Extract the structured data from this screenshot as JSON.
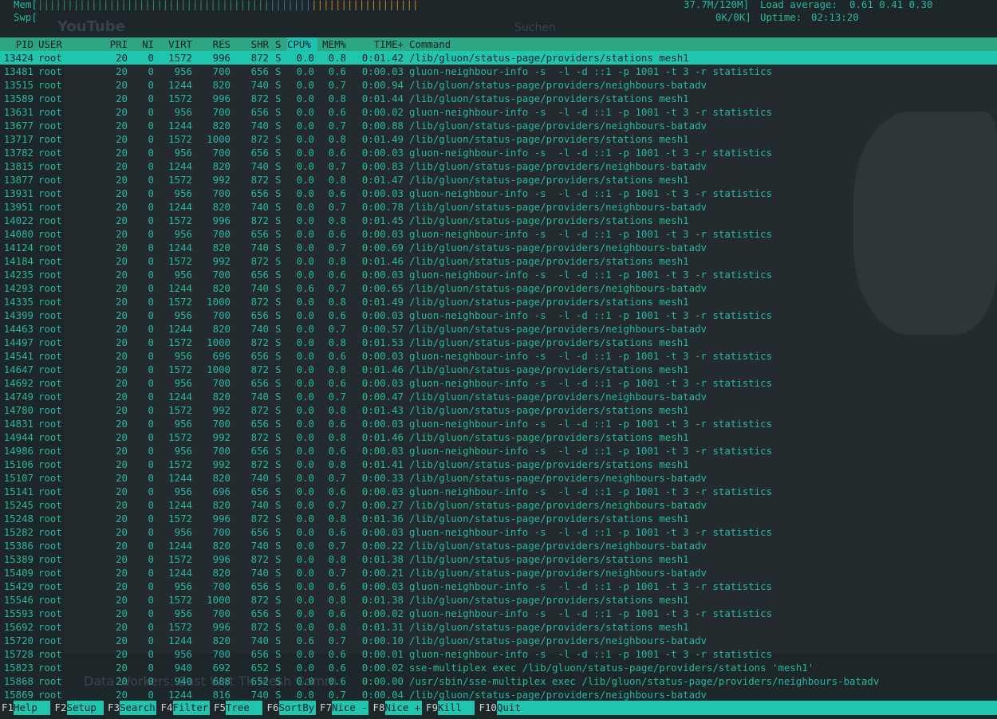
{
  "background": {
    "site_logo": "YouTube",
    "search_placeholder": "Suchen",
    "video_title": "Data Workers: East Wat Tk Mesh Comm"
  },
  "header": {
    "mem_label": "Mem[",
    "mem_bar": "||||||||||||||||||||||||||||||||||||||||||||||||||||||||||||||||||||",
    "mem_value": "37.7M/120M]",
    "swp_label": "Swp[",
    "swp_value": "0K/0K]",
    "load_label": "Load average:",
    "load_values": "0.61 0.41 0.30",
    "uptime_label": "Uptime:",
    "uptime_value": "02:13:20"
  },
  "columns": [
    "PID",
    "USER",
    "PRI",
    "NI",
    "VIRT",
    "RES",
    "SHR",
    "S",
    "CPU%",
    "MEM%",
    "TIME+",
    "Command"
  ],
  "sort_column": "CPU%",
  "selected_index": 0,
  "processes": [
    [
      "13424",
      "root",
      "20",
      "0",
      "1572",
      "996",
      "872",
      "S",
      "0.0",
      "0.8",
      "0:01.42",
      "/lib/gluon/status-page/providers/stations mesh1"
    ],
    [
      "13481",
      "root",
      "20",
      "0",
      "956",
      "700",
      "656",
      "S",
      "0.0",
      "0.6",
      "0:00.03",
      "gluon-neighbour-info -s  -l -d ::1 -p 1001 -t 3 -r statistics"
    ],
    [
      "13515",
      "root",
      "20",
      "0",
      "1244",
      "820",
      "740",
      "S",
      "0.0",
      "0.7",
      "0:00.94",
      "/lib/gluon/status-page/providers/neighbours-batadv"
    ],
    [
      "13589",
      "root",
      "20",
      "0",
      "1572",
      "996",
      "872",
      "S",
      "0.0",
      "0.8",
      "0:01.44",
      "/lib/gluon/status-page/providers/stations mesh1"
    ],
    [
      "13631",
      "root",
      "20",
      "0",
      "956",
      "700",
      "656",
      "S",
      "0.0",
      "0.6",
      "0:00.02",
      "gluon-neighbour-info -s  -l -d ::1 -p 1001 -t 3 -r statistics"
    ],
    [
      "13677",
      "root",
      "20",
      "0",
      "1244",
      "820",
      "740",
      "S",
      "0.0",
      "0.7",
      "0:00.88",
      "/lib/gluon/status-page/providers/neighbours-batadv"
    ],
    [
      "13717",
      "root",
      "20",
      "0",
      "1572",
      "1000",
      "872",
      "S",
      "0.0",
      "0.8",
      "0:01.49",
      "/lib/gluon/status-page/providers/stations mesh1"
    ],
    [
      "13782",
      "root",
      "20",
      "0",
      "956",
      "700",
      "656",
      "S",
      "0.0",
      "0.6",
      "0:00.03",
      "gluon-neighbour-info -s  -l -d ::1 -p 1001 -t 3 -r statistics"
    ],
    [
      "13815",
      "root",
      "20",
      "0",
      "1244",
      "820",
      "740",
      "S",
      "0.0",
      "0.7",
      "0:00.83",
      "/lib/gluon/status-page/providers/neighbours-batadv"
    ],
    [
      "13877",
      "root",
      "20",
      "0",
      "1572",
      "992",
      "872",
      "S",
      "0.0",
      "0.8",
      "0:01.47",
      "/lib/gluon/status-page/providers/stations mesh1"
    ],
    [
      "13931",
      "root",
      "20",
      "0",
      "956",
      "700",
      "656",
      "S",
      "0.0",
      "0.6",
      "0:00.03",
      "gluon-neighbour-info -s  -l -d ::1 -p 1001 -t 3 -r statistics"
    ],
    [
      "13951",
      "root",
      "20",
      "0",
      "1244",
      "820",
      "740",
      "S",
      "0.0",
      "0.7",
      "0:00.78",
      "/lib/gluon/status-page/providers/neighbours-batadv"
    ],
    [
      "14022",
      "root",
      "20",
      "0",
      "1572",
      "996",
      "872",
      "S",
      "0.0",
      "0.8",
      "0:01.45",
      "/lib/gluon/status-page/providers/stations mesh1"
    ],
    [
      "14080",
      "root",
      "20",
      "0",
      "956",
      "700",
      "656",
      "S",
      "0.0",
      "0.6",
      "0:00.03",
      "gluon-neighbour-info -s  -l -d ::1 -p 1001 -t 3 -r statistics"
    ],
    [
      "14124",
      "root",
      "20",
      "0",
      "1244",
      "820",
      "740",
      "S",
      "0.0",
      "0.7",
      "0:00.69",
      "/lib/gluon/status-page/providers/neighbours-batadv"
    ],
    [
      "14184",
      "root",
      "20",
      "0",
      "1572",
      "992",
      "872",
      "S",
      "0.0",
      "0.8",
      "0:01.46",
      "/lib/gluon/status-page/providers/stations mesh1"
    ],
    [
      "14235",
      "root",
      "20",
      "0",
      "956",
      "700",
      "656",
      "S",
      "0.0",
      "0.6",
      "0:00.03",
      "gluon-neighbour-info -s  -l -d ::1 -p 1001 -t 3 -r statistics"
    ],
    [
      "14293",
      "root",
      "20",
      "0",
      "1244",
      "820",
      "740",
      "S",
      "0.6",
      "0.7",
      "0:00.65",
      "/lib/gluon/status-page/providers/neighbours-batadv"
    ],
    [
      "14335",
      "root",
      "20",
      "0",
      "1572",
      "1000",
      "872",
      "S",
      "0.0",
      "0.8",
      "0:01.49",
      "/lib/gluon/status-page/providers/stations mesh1"
    ],
    [
      "14399",
      "root",
      "20",
      "0",
      "956",
      "700",
      "656",
      "S",
      "0.0",
      "0.6",
      "0:00.03",
      "gluon-neighbour-info -s  -l -d ::1 -p 1001 -t 3 -r statistics"
    ],
    [
      "14463",
      "root",
      "20",
      "0",
      "1244",
      "820",
      "740",
      "S",
      "0.0",
      "0.7",
      "0:00.57",
      "/lib/gluon/status-page/providers/neighbours-batadv"
    ],
    [
      "14497",
      "root",
      "20",
      "0",
      "1572",
      "1000",
      "872",
      "S",
      "0.0",
      "0.8",
      "0:01.53",
      "/lib/gluon/status-page/providers/stations mesh1"
    ],
    [
      "14541",
      "root",
      "20",
      "0",
      "956",
      "696",
      "656",
      "S",
      "0.0",
      "0.6",
      "0:00.03",
      "gluon-neighbour-info -s  -l -d ::1 -p 1001 -t 3 -r statistics"
    ],
    [
      "14647",
      "root",
      "20",
      "0",
      "1572",
      "1000",
      "872",
      "S",
      "0.0",
      "0.8",
      "0:01.46",
      "/lib/gluon/status-page/providers/stations mesh1"
    ],
    [
      "14692",
      "root",
      "20",
      "0",
      "956",
      "700",
      "656",
      "S",
      "0.0",
      "0.6",
      "0:00.03",
      "gluon-neighbour-info -s  -l -d ::1 -p 1001 -t 3 -r statistics"
    ],
    [
      "14749",
      "root",
      "20",
      "0",
      "1244",
      "820",
      "740",
      "S",
      "0.0",
      "0.7",
      "0:00.47",
      "/lib/gluon/status-page/providers/neighbours-batadv"
    ],
    [
      "14780",
      "root",
      "20",
      "0",
      "1572",
      "992",
      "872",
      "S",
      "0.0",
      "0.8",
      "0:01.43",
      "/lib/gluon/status-page/providers/stations mesh1"
    ],
    [
      "14831",
      "root",
      "20",
      "0",
      "956",
      "700",
      "656",
      "S",
      "0.0",
      "0.6",
      "0:00.03",
      "gluon-neighbour-info -s  -l -d ::1 -p 1001 -t 3 -r statistics"
    ],
    [
      "14944",
      "root",
      "20",
      "0",
      "1572",
      "992",
      "872",
      "S",
      "0.0",
      "0.8",
      "0:01.46",
      "/lib/gluon/status-page/providers/stations mesh1"
    ],
    [
      "14986",
      "root",
      "20",
      "0",
      "956",
      "700",
      "656",
      "S",
      "0.0",
      "0.6",
      "0:00.03",
      "gluon-neighbour-info -s  -l -d ::1 -p 1001 -t 3 -r statistics"
    ],
    [
      "15106",
      "root",
      "20",
      "0",
      "1572",
      "992",
      "872",
      "S",
      "0.0",
      "0.8",
      "0:01.41",
      "/lib/gluon/status-page/providers/stations mesh1"
    ],
    [
      "15107",
      "root",
      "20",
      "0",
      "1244",
      "820",
      "740",
      "S",
      "0.0",
      "0.7",
      "0:00.33",
      "/lib/gluon/status-page/providers/neighbours-batadv"
    ],
    [
      "15141",
      "root",
      "20",
      "0",
      "956",
      "696",
      "656",
      "S",
      "0.0",
      "0.6",
      "0:00.03",
      "gluon-neighbour-info -s  -l -d ::1 -p 1001 -t 3 -r statistics"
    ],
    [
      "15245",
      "root",
      "20",
      "0",
      "1244",
      "820",
      "740",
      "S",
      "0.0",
      "0.7",
      "0:00.27",
      "/lib/gluon/status-page/providers/neighbours-batadv"
    ],
    [
      "15248",
      "root",
      "20",
      "0",
      "1572",
      "996",
      "872",
      "S",
      "0.0",
      "0.8",
      "0:01.36",
      "/lib/gluon/status-page/providers/stations mesh1"
    ],
    [
      "15282",
      "root",
      "20",
      "0",
      "956",
      "700",
      "656",
      "S",
      "0.0",
      "0.6",
      "0:00.03",
      "gluon-neighbour-info -s  -l -d ::1 -p 1001 -t 3 -r statistics"
    ],
    [
      "15386",
      "root",
      "20",
      "0",
      "1244",
      "820",
      "740",
      "S",
      "0.0",
      "0.7",
      "0:00.22",
      "/lib/gluon/status-page/providers/neighbours-batadv"
    ],
    [
      "15389",
      "root",
      "20",
      "0",
      "1572",
      "996",
      "872",
      "S",
      "0.0",
      "0.8",
      "0:01.38",
      "/lib/gluon/status-page/providers/stations mesh1"
    ],
    [
      "15409",
      "root",
      "20",
      "0",
      "1244",
      "820",
      "740",
      "S",
      "0.0",
      "0.7",
      "0:00.21",
      "/lib/gluon/status-page/providers/neighbours-batadv"
    ],
    [
      "15429",
      "root",
      "20",
      "0",
      "956",
      "700",
      "656",
      "S",
      "0.0",
      "0.6",
      "0:00.03",
      "gluon-neighbour-info -s  -l -d ::1 -p 1001 -t 3 -r statistics"
    ],
    [
      "15546",
      "root",
      "20",
      "0",
      "1572",
      "1000",
      "872",
      "S",
      "0.0",
      "0.8",
      "0:01.38",
      "/lib/gluon/status-page/providers/stations mesh1"
    ],
    [
      "15593",
      "root",
      "20",
      "0",
      "956",
      "700",
      "656",
      "S",
      "0.0",
      "0.6",
      "0:00.02",
      "gluon-neighbour-info -s  -l -d ::1 -p 1001 -t 3 -r statistics"
    ],
    [
      "15692",
      "root",
      "20",
      "0",
      "1572",
      "996",
      "872",
      "S",
      "0.0",
      "0.8",
      "0:01.31",
      "/lib/gluon/status-page/providers/stations mesh1"
    ],
    [
      "15720",
      "root",
      "20",
      "0",
      "1244",
      "820",
      "740",
      "S",
      "0.6",
      "0.7",
      "0:00.10",
      "/lib/gluon/status-page/providers/neighbours-batadv"
    ],
    [
      "15728",
      "root",
      "20",
      "0",
      "956",
      "700",
      "656",
      "S",
      "0.0",
      "0.6",
      "0:00.01",
      "gluon-neighbour-info -s  -l -d ::1 -p 1001 -t 3 -r statistics"
    ],
    [
      "15823",
      "root",
      "20",
      "0",
      "940",
      "692",
      "652",
      "S",
      "0.0",
      "0.6",
      "0:00.02",
      "sse-multiplex exec /lib/gluon/status-page/providers/stations 'mesh1'"
    ],
    [
      "15868",
      "root",
      "20",
      "0",
      "940",
      "688",
      "652",
      "S",
      "0.0",
      "0.6",
      "0:00.00",
      "/usr/sbin/sse-multiplex exec /lib/gluon/status-page/providers/neighbours-batadv"
    ],
    [
      "15869",
      "root",
      "20",
      "0",
      "1244",
      "816",
      "740",
      "S",
      "0.0",
      "0.7",
      "0:00.04",
      "/lib/gluon/status-page/providers/neighbours-batadv"
    ]
  ],
  "footer": [
    {
      "key": "F1",
      "label": "Help  "
    },
    {
      "key": "F2",
      "label": "Setup "
    },
    {
      "key": "F3",
      "label": "Search"
    },
    {
      "key": "F4",
      "label": "Filter"
    },
    {
      "key": "F5",
      "label": "Tree  "
    },
    {
      "key": "F6",
      "label": "SortBy"
    },
    {
      "key": "F7",
      "label": "Nice -"
    },
    {
      "key": "F8",
      "label": "Nice +"
    },
    {
      "key": "F9",
      "label": "Kill  "
    },
    {
      "key": "F10",
      "label": "Quit"
    }
  ],
  "colors": {
    "background": "#1d2629",
    "text": "#2bb5a3",
    "header_bar": "#2ca683",
    "selection": "#20c5ae"
  }
}
